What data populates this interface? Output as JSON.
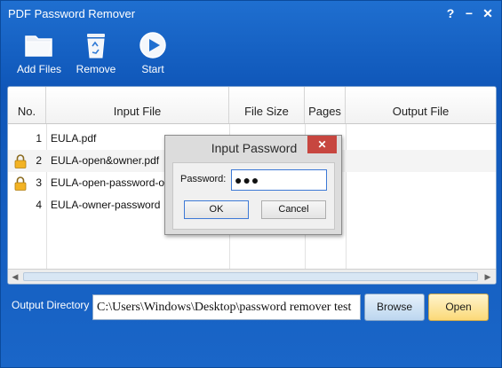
{
  "window": {
    "title": "PDF Password Remover"
  },
  "titlebar_buttons": {
    "help": "?",
    "minimize": "−",
    "close": "✕"
  },
  "toolbar": {
    "add_files": "Add Files",
    "remove": "Remove",
    "start": "Start"
  },
  "table": {
    "headers": [
      "No.",
      "Input File",
      "File Size",
      "Pages",
      "Output File"
    ],
    "rows": [
      {
        "no": "1",
        "input_file": "EULA.pdf",
        "locked": false
      },
      {
        "no": "2",
        "input_file": "EULA-open&owner.pdf",
        "locked": true
      },
      {
        "no": "3",
        "input_file": "EULA-open-password-o",
        "locked": true
      },
      {
        "no": "4",
        "input_file": "EULA-owner-password",
        "locked": false
      }
    ]
  },
  "output": {
    "label": "Output Directory",
    "path": "C:\\Users\\Windows\\Desktop\\password remover test",
    "browse": "Browse",
    "open": "Open"
  },
  "dialog": {
    "title": "Input Password",
    "close": "✕",
    "password_label": "Password:",
    "password_value": "●●●",
    "ok": "OK",
    "cancel": "Cancel"
  },
  "colors": {
    "window_blue": "#1560c2",
    "open_button": "#fbd978",
    "browse_button": "#bcd6ef",
    "dialog_close": "#c7463f"
  }
}
